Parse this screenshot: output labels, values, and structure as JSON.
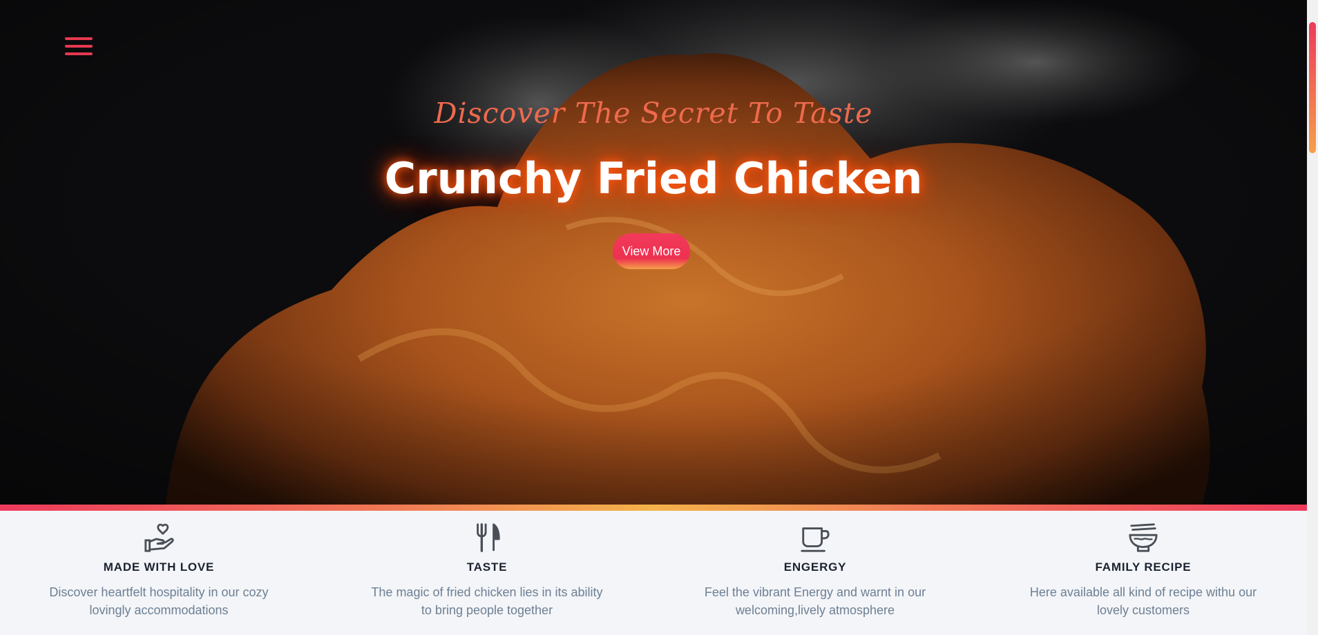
{
  "hero": {
    "tagline": "Discover The Secret To Taste",
    "title": "Crunchy Fried Chicken",
    "cta_label": "View More",
    "menu_icon": "hamburger-menu-icon"
  },
  "colors": {
    "accent": "#ee3150",
    "tagline": "#ef6a4d",
    "gradient_mid": "#f3b34b",
    "feature_title": "#1b2330",
    "feature_text": "#6d7f94"
  },
  "features": [
    {
      "icon": "hand-heart-icon",
      "title": "MADE WITH LOVE",
      "line1": "Discover heartfelt hospitality in our cozy",
      "line2": "lovingly accommodations"
    },
    {
      "icon": "fork-knife-icon",
      "title": "TASTE",
      "line1": "The magic of fried chicken lies in its ability",
      "line2": "to bring people together"
    },
    {
      "icon": "coffee-cup-icon",
      "title": "ENGERGY",
      "line1": "Feel the vibrant Energy and warnt in our",
      "line2": "welcoming,lively atmosphere"
    },
    {
      "icon": "noodle-bowl-icon",
      "title": "FAMILY RECIPE",
      "line1": "Here available all kind of recipe withu our",
      "line2": "lovely customers"
    }
  ]
}
